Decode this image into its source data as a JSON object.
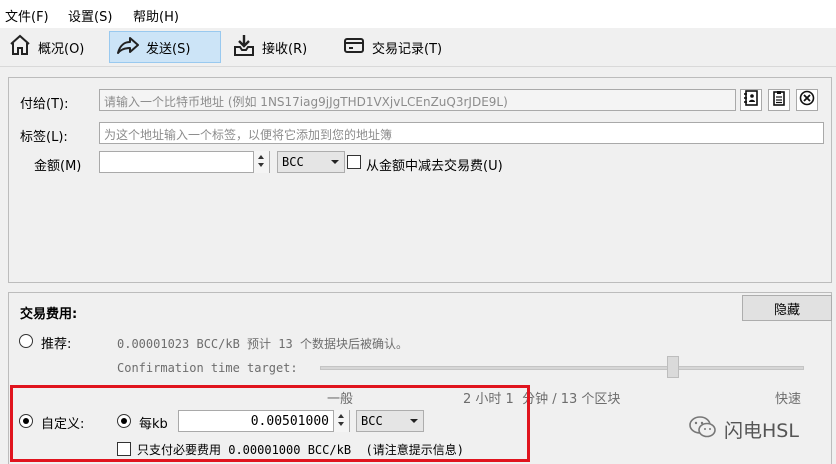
{
  "menu": {
    "file": "文件(F)",
    "settings": "设置(S)",
    "help": "帮助(H)"
  },
  "tabs": [
    {
      "label": "概况(O)",
      "icon": "home-icon"
    },
    {
      "label": "发送(S)",
      "icon": "send-icon"
    },
    {
      "label": "接收(R)",
      "icon": "receive-icon"
    },
    {
      "label": "交易记录(T)",
      "icon": "transactions-icon"
    }
  ],
  "send": {
    "pay_to_label": "付给(T):",
    "pay_to_placeholder": "请输入一个比特币地址 (例如 1NS17iag9jJgTHD1VXjvLCEnZuQ3rJDE9L)",
    "label_label": "标签(L):",
    "label_placeholder": "为这个地址输入一个标签，以便将它添加到您的地址簿",
    "amount_label": "金额(M)",
    "amount_value": "",
    "unit": "BCC",
    "subtract_fee_label": "从金额中减去交易费(U)"
  },
  "fee": {
    "title": "交易费用:",
    "hide_button": "隐藏",
    "recommended_label": "推荐:",
    "recommended_text": "0.00001023 BCC/kB 预计 13 个数据块后被确认。",
    "confirmation_label": "Confirmation time target:",
    "slider_level": 0.73,
    "scale_normal": "一般",
    "scale_middle": "2 小时 1  分钟 / 13 个区块",
    "scale_fast": "快速",
    "custom_label": "自定义:",
    "per_kb_label": "每kb",
    "per_kb_value": "0.00501000",
    "per_kb_unit": "BCC",
    "min_fee_label": "只支付必要费用 0.00001000 BCC/kB  (请注意提示信息)"
  },
  "watermark": {
    "text": "闪电HSL"
  }
}
